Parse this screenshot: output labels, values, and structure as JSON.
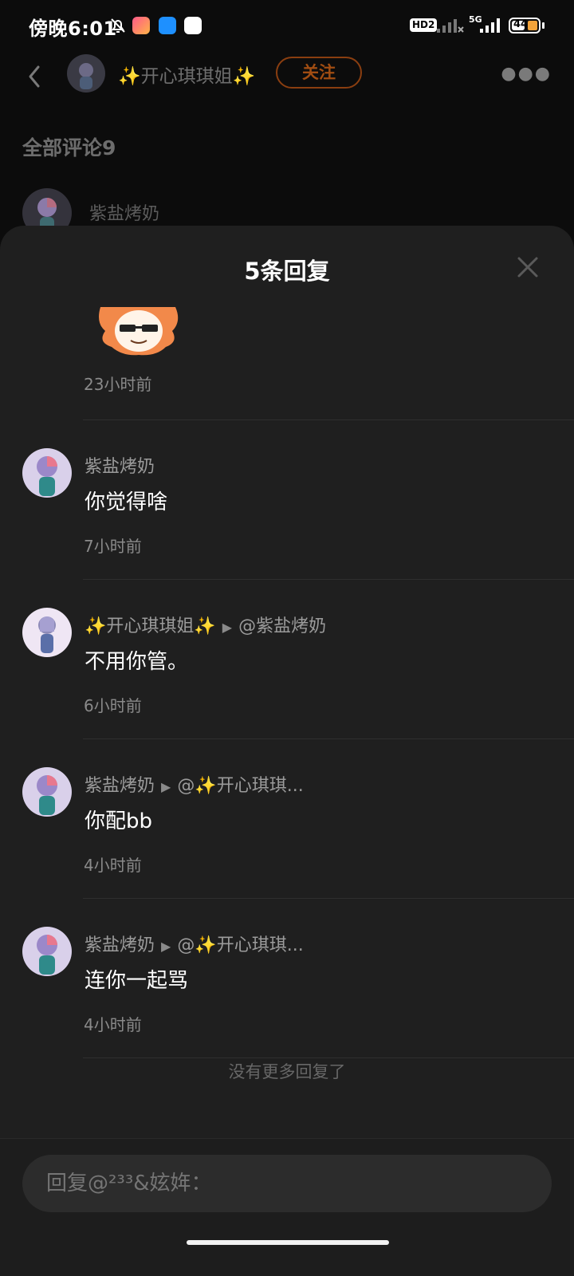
{
  "status": {
    "time": "傍晚6:01",
    "network_badge": "HD2",
    "network_type": "5G",
    "battery": "44",
    "icons": [
      "bell-off-icon",
      "app-icon",
      "app-icon",
      "app-icon",
      "signal-icon",
      "signal-icon",
      "battery-icon"
    ]
  },
  "background_page": {
    "author_name": "✨开心琪琪姐✨",
    "follow_label": "关注",
    "comments_title": "全部评论9",
    "first_commenter": "紫盐烤奶"
  },
  "sheet": {
    "title": "5条回复",
    "first_reply_time": "23小时前",
    "replies": [
      {
        "name": "紫盐烤奶",
        "target": "",
        "text": "你觉得啥",
        "time": "7小时前"
      },
      {
        "name": "✨开心琪琪姐✨",
        "target": "@紫盐烤奶",
        "text": "不用你管。",
        "time": "6小时前"
      },
      {
        "name": "紫盐烤奶",
        "target": "@✨开心琪琪...",
        "text": "你配bb",
        "time": "4小时前"
      },
      {
        "name": "紫盐烤奶",
        "target": "@✨开心琪琪...",
        "text": "连你一起骂",
        "time": "4小时前"
      }
    ],
    "no_more": "没有更多回复了",
    "reply_placeholder": "回复@²³³&妶姩："
  },
  "colors": {
    "follow": "#a14d12",
    "sheet_bg": "#1f1f1f",
    "sticker": "#f2894a"
  }
}
